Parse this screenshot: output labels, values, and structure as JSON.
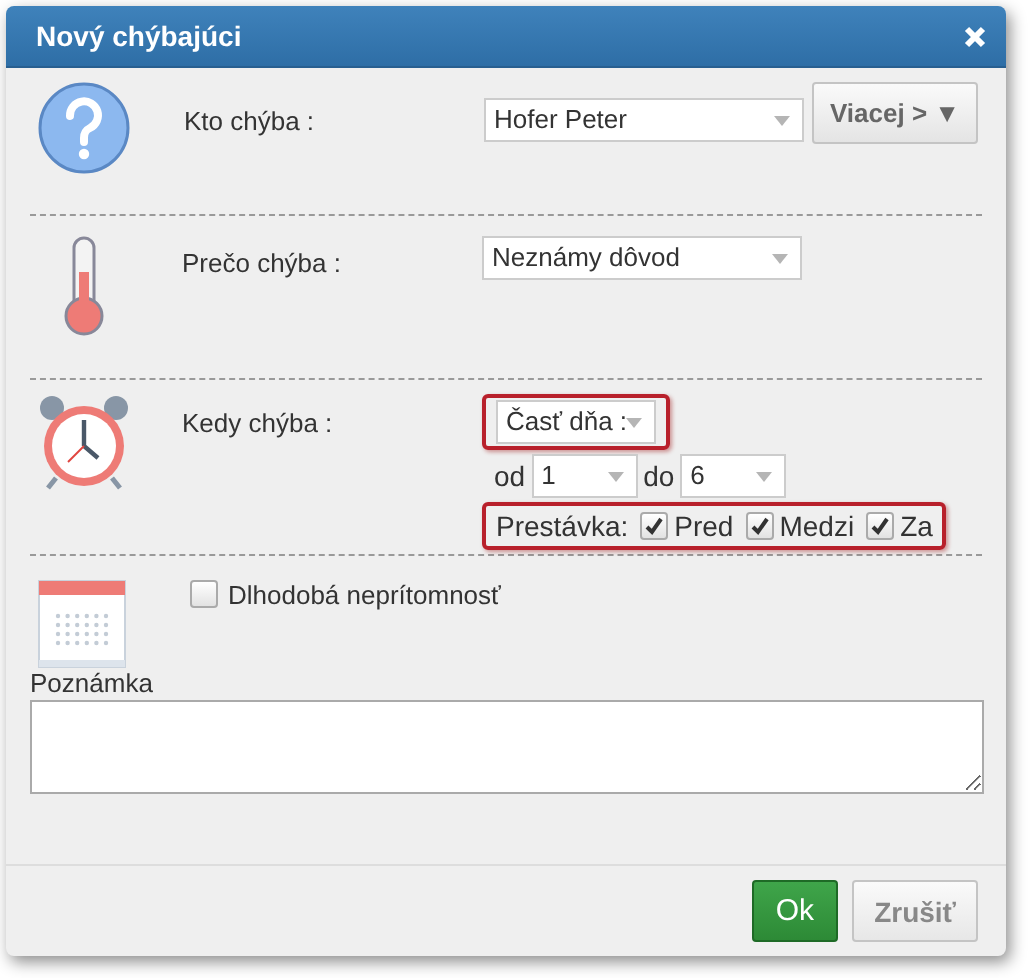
{
  "dialog": {
    "title": "Nový chýbajúci"
  },
  "sections": [
    {
      "kind": "person",
      "label": "Kto chýba :",
      "select": {
        "value": "Hofer Peter"
      },
      "button": "Viacej > ▼"
    },
    {
      "kind": "reason",
      "label": "Prečo chýba :",
      "select": {
        "value": "Neznámy dôvod"
      }
    },
    {
      "kind": "time",
      "label": "Kedy chýba :",
      "day_part": {
        "value": "Časť dňa :",
        "highlighted": true
      },
      "from": {
        "label": "od",
        "value": "1"
      },
      "to": {
        "label": "do",
        "value": "6"
      },
      "break": {
        "label": "Prestávka:",
        "highlighted": true,
        "options": [
          {
            "label": "Pred",
            "checked": true
          },
          {
            "label": "Medzi",
            "checked": true
          },
          {
            "label": "Za",
            "checked": true
          }
        ]
      }
    },
    {
      "kind": "longterm",
      "checkbox": {
        "label": "Dlhodobá neprítomnosť",
        "checked": false
      }
    }
  ],
  "note": {
    "label": "Poznámka"
  },
  "buttons": [
    {
      "label": "Ok",
      "kind": "primary"
    },
    {
      "label": "Zrušiť",
      "kind": "default"
    }
  ]
}
